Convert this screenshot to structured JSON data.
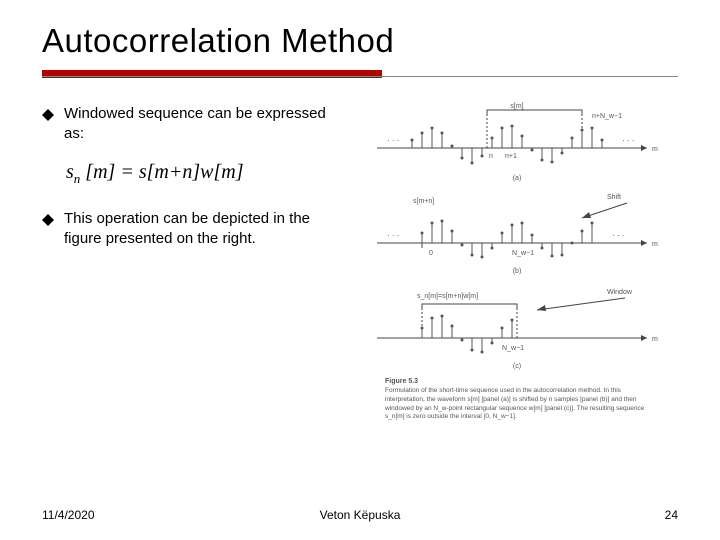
{
  "title": "Autocorrelation Method",
  "bullets": [
    {
      "text": "Windowed sequence can be expressed as:"
    },
    {
      "text": "This operation can be depicted in the figure presented on the right."
    }
  ],
  "formula": {
    "lhs_base": "s",
    "lhs_sub": "n",
    "lhs_arg": "[m]",
    "eq": "=",
    "r1_base": "s",
    "r1_arg": "[m+n]",
    "r2_base": "w",
    "r2_arg": "[m]"
  },
  "figure": {
    "signal_top": "s[m]",
    "win_right": "n+N_w−1",
    "axis_m": "m",
    "n_label": "n",
    "n1_label": "n+1",
    "panel_a": "(a)",
    "shift_label": "Shift",
    "seq_mid": "s[m+n]",
    "zero_label": "0",
    "nw1_label": "N_w−1",
    "panel_b": "(b)",
    "window_label": "Window",
    "seq_bot": "s_n[m]=s[m+n]w[m]",
    "nw_label": "N_w−1",
    "panel_c": "(c)",
    "caption_strong": "Figure 5.3",
    "caption_body": "Formulation of the short-time sequence used in the autocorrelation method. In this interpretation, the waveform s[m] [panel (a)] is shifted by n samples [panel (b)] and then windowed by an N_w-point rectangular sequence w[m] [panel (c)]. The resulting sequence s_n[m] is zero outside the interval [0, N_w−1]."
  },
  "footer": {
    "date": "11/4/2020",
    "author": "Veton Këpuska",
    "page": "24"
  }
}
